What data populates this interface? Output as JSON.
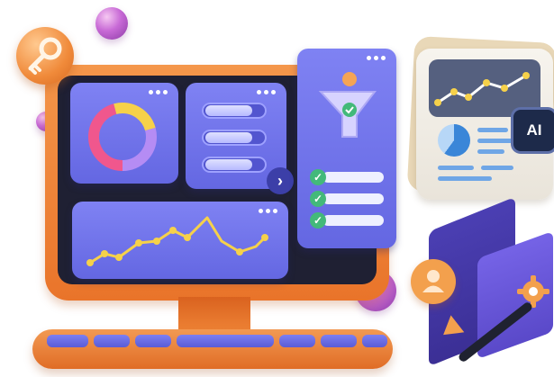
{
  "colors": {
    "monitor_orange": "#ef8436",
    "panel_purple": "#6f72ea",
    "screen_dark": "#1f2033",
    "check_green": "#43b97a",
    "orb_pink": "#c86ad6",
    "chart_point_yellow": "#f6d14a"
  },
  "icons": {
    "key": "key-icon",
    "funnel": "funnel-icon",
    "check": "check-icon",
    "chevron": "chevron-right-icon",
    "user": "user-icon",
    "gear": "gear-icon"
  },
  "ai_card": {
    "chip_label": "AI"
  }
}
